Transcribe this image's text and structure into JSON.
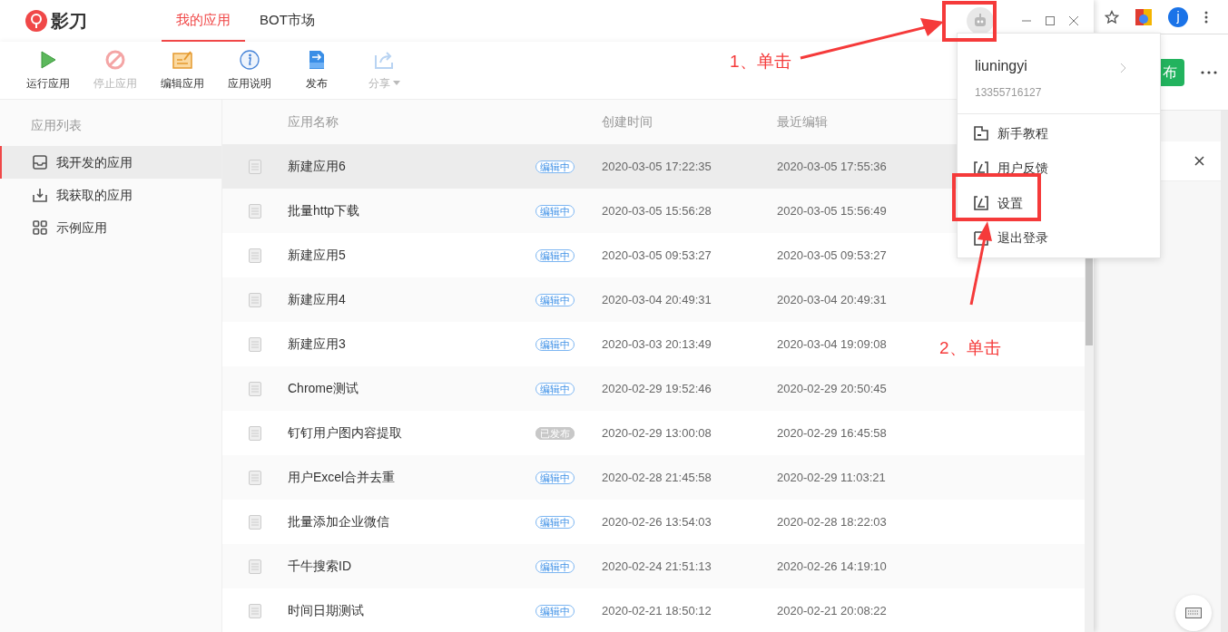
{
  "app": {
    "logo": "影刀",
    "tabs": [
      {
        "label": "我的应用",
        "selected": true
      },
      {
        "label": "BOT市场",
        "selected": false
      }
    ]
  },
  "toolbar": [
    {
      "label": "运行应用",
      "disabled": false
    },
    {
      "label": "停止应用",
      "disabled": true
    },
    {
      "label": "编辑应用",
      "disabled": false
    },
    {
      "label": "应用说明",
      "disabled": false
    },
    {
      "label": "发布",
      "disabled": false
    },
    {
      "label": "分享",
      "disabled": true
    }
  ],
  "sidebar": {
    "title": "应用列表",
    "items": [
      {
        "label": "我开发的应用",
        "selected": true
      },
      {
        "label": "我获取的应用",
        "selected": false
      },
      {
        "label": "示例应用",
        "selected": false
      }
    ]
  },
  "table": {
    "columns": [
      "应用名称",
      "创建时间",
      "最近编辑"
    ],
    "rows": [
      {
        "name": "新建应用6",
        "status": {
          "kind": "editing",
          "label": "编辑中"
        },
        "created": "2020-03-05 17:22:35",
        "edited": "2020-03-05 17:55:36",
        "selected": true
      },
      {
        "name": "批量http下载",
        "status": {
          "kind": "editing",
          "label": "编辑中"
        },
        "created": "2020-03-05 15:56:28",
        "edited": "2020-03-05 15:56:49",
        "selected": false
      },
      {
        "name": "新建应用5",
        "status": {
          "kind": "editing",
          "label": "编辑中"
        },
        "created": "2020-03-05 09:53:27",
        "edited": "2020-03-05 09:53:27",
        "selected": false
      },
      {
        "name": "新建应用4",
        "status": {
          "kind": "editing",
          "label": "编辑中"
        },
        "created": "2020-03-04 20:49:31",
        "edited": "2020-03-04 20:49:31",
        "selected": false
      },
      {
        "name": "新建应用3",
        "status": {
          "kind": "editing",
          "label": "编辑中"
        },
        "created": "2020-03-03 20:13:49",
        "edited": "2020-03-04 19:09:08",
        "selected": false
      },
      {
        "name": "Chrome测试",
        "status": {
          "kind": "editing",
          "label": "编辑中"
        },
        "created": "2020-02-29 19:52:46",
        "edited": "2020-02-29 20:50:45",
        "selected": false
      },
      {
        "name": "钉钉用户图内容提取",
        "status": {
          "kind": "published",
          "label": "已发布"
        },
        "created": "2020-02-29 13:00:08",
        "edited": "2020-02-29 16:45:58",
        "selected": false
      },
      {
        "name": "用户Excel合并去重",
        "status": {
          "kind": "editing",
          "label": "编辑中"
        },
        "created": "2020-02-28 21:45:58",
        "edited": "2020-02-29 11:03:21",
        "selected": false
      },
      {
        "name": "批量添加企业微信",
        "status": {
          "kind": "editing",
          "label": "编辑中"
        },
        "created": "2020-02-26 13:54:03",
        "edited": "2020-02-28 18:22:03",
        "selected": false
      },
      {
        "name": "千牛搜索ID",
        "status": {
          "kind": "editing",
          "label": "编辑中"
        },
        "created": "2020-02-24 21:51:13",
        "edited": "2020-02-26 14:19:10",
        "selected": false
      },
      {
        "name": "时间日期测试",
        "status": {
          "kind": "editing",
          "label": "编辑中"
        },
        "created": "2020-02-21 18:50:12",
        "edited": "2020-02-21 20:08:22",
        "selected": false
      }
    ]
  },
  "user_menu": {
    "username": "liuningyi",
    "phone": "13355716127",
    "items": [
      {
        "label": "新手教程"
      },
      {
        "label": "用户反馈"
      },
      {
        "label": "设置"
      },
      {
        "label": "退出登录"
      }
    ]
  },
  "browser": {
    "profile": "j",
    "button": "布"
  },
  "annotations": [
    {
      "text": "1、单击"
    },
    {
      "text": "2、单击"
    }
  ]
}
